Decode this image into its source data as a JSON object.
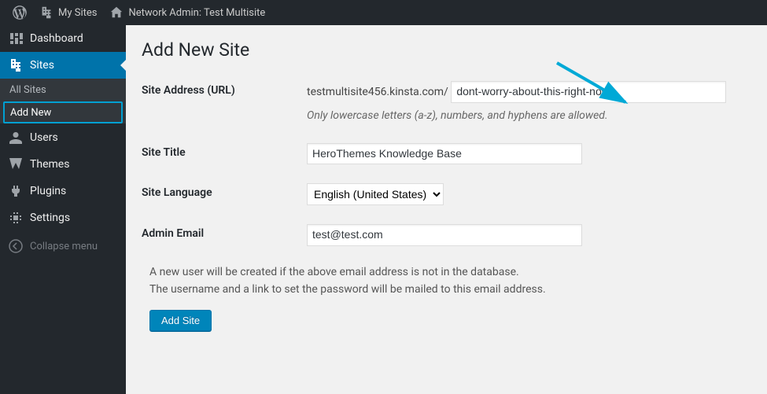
{
  "adminbar": {
    "my_sites_label": "My Sites",
    "network_admin_label": "Network Admin: Test Multisite"
  },
  "sidebar": {
    "items": [
      {
        "label": "Dashboard"
      },
      {
        "label": "Sites"
      },
      {
        "label": "Users"
      },
      {
        "label": "Themes"
      },
      {
        "label": "Plugins"
      },
      {
        "label": "Settings"
      }
    ],
    "submenu": [
      {
        "label": "All Sites"
      },
      {
        "label": "Add New"
      }
    ],
    "collapse_label": "Collapse menu"
  },
  "page": {
    "title": "Add New Site",
    "labels": {
      "site_address": "Site Address (URL)",
      "site_title": "Site Title",
      "site_language": "Site Language",
      "admin_email": "Admin Email"
    },
    "url_prefix": "testmultisite456.kinsta.com/",
    "url_value": "dont-worry-about-this-right-now",
    "url_hint": "Only lowercase letters (a-z), numbers, and hyphens are allowed.",
    "title_value": "HeroThemes Knowledge Base",
    "language_selected": "English (United States)",
    "email_value": "test@test.com",
    "note_line1": "A new user will be created if the above email address is not in the database.",
    "note_line2": "The username and a link to set the password will be mailed to this email address.",
    "submit_label": "Add Site"
  }
}
